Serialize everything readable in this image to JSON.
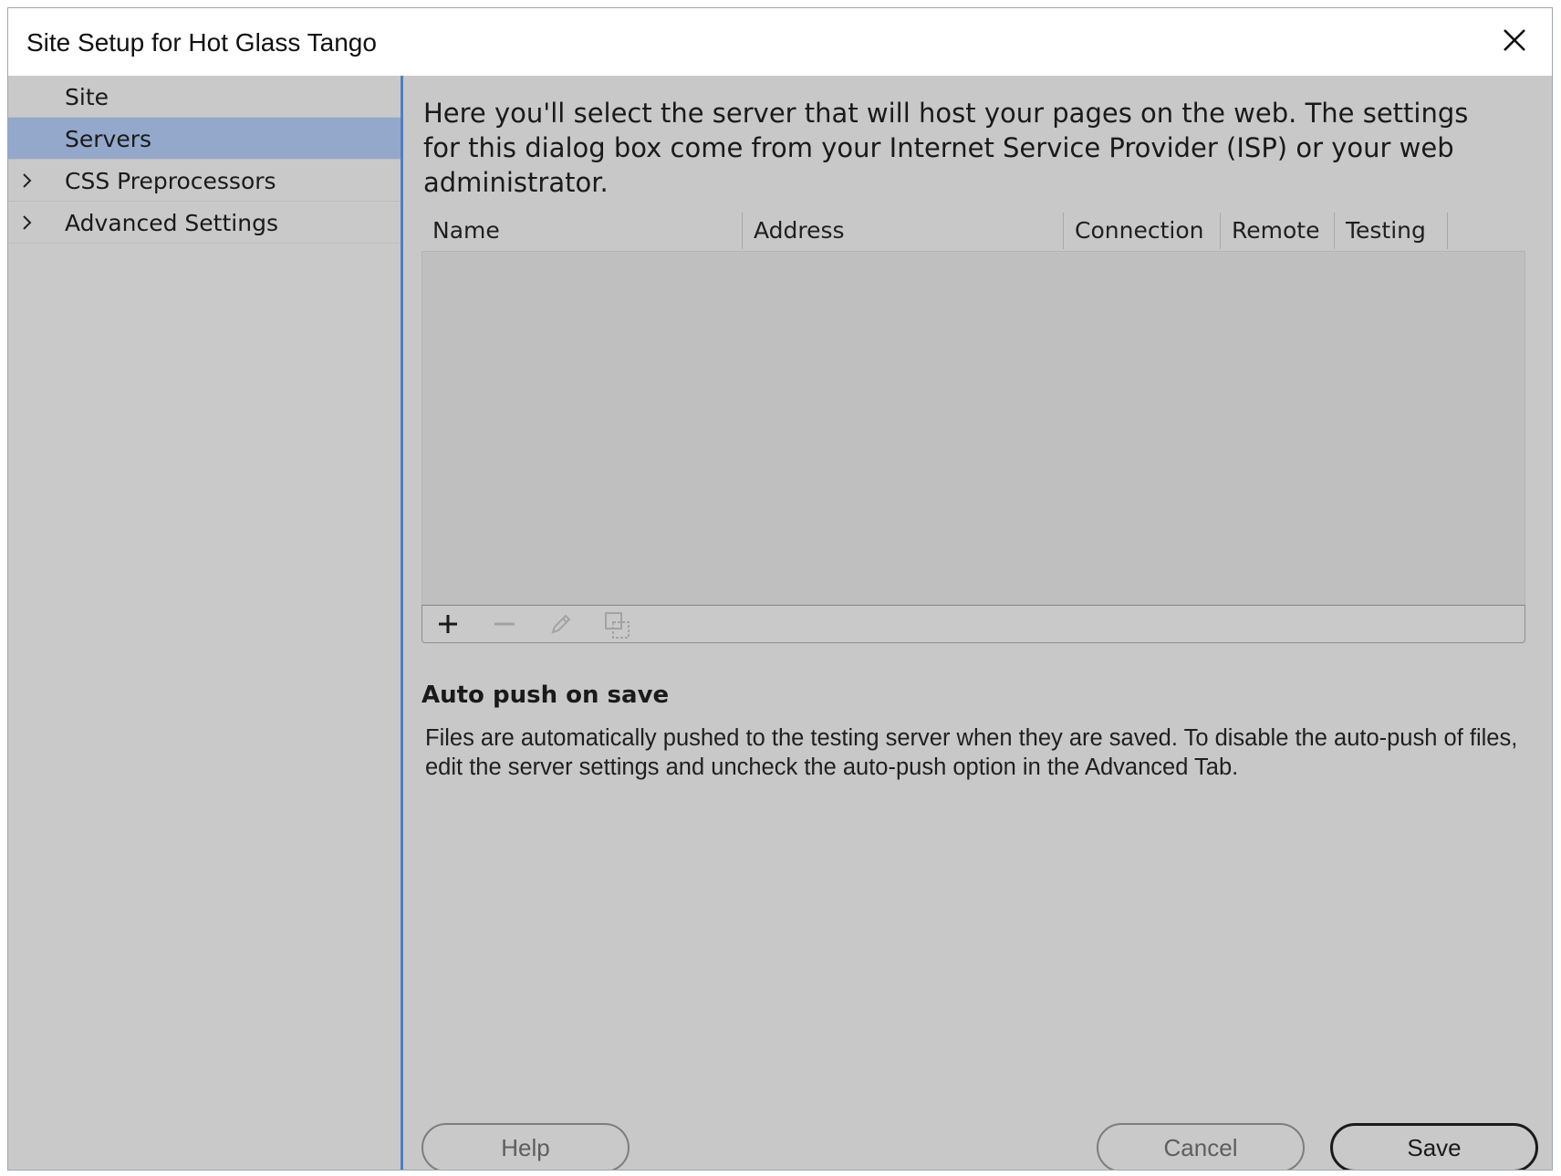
{
  "window": {
    "title": "Site Setup for Hot Glass Tango"
  },
  "sidebar": {
    "items": [
      {
        "label": "Site",
        "selected": false,
        "expandable": false
      },
      {
        "label": "Servers",
        "selected": true,
        "expandable": false
      },
      {
        "label": "CSS Preprocessors",
        "selected": false,
        "expandable": true
      },
      {
        "label": "Advanced Settings",
        "selected": false,
        "expandable": true
      }
    ]
  },
  "main": {
    "intro": "Here you'll select the server that will host your pages on the web. The settings for this dialog box come from your Internet Service Provider (ISP) or your web administrator.",
    "table": {
      "columns": [
        "Name",
        "Address",
        "Connection",
        "Remote",
        "Testing"
      ],
      "rows": []
    },
    "toolbar": {
      "icons": [
        "plus-icon",
        "minus-icon",
        "pencil-icon",
        "duplicate-icon"
      ]
    },
    "auto_push": {
      "title": "Auto push on save",
      "body": "Files are automatically pushed to the testing server when they are saved. To disable the auto-push of files, edit the server settings and uncheck the auto-push option in the Advanced Tab."
    }
  },
  "footer": {
    "help_label": "Help",
    "cancel_label": "Cancel",
    "save_label": "Save"
  },
  "colors": {
    "selection": "#93a8cb",
    "divider_accent": "#4f7fc0",
    "panel_bg": "#c9c9c9"
  }
}
